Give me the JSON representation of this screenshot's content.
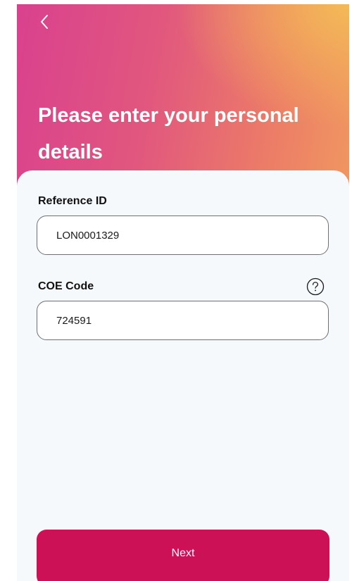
{
  "header": {
    "back_icon": "chevron-left-icon",
    "title": "Please enter your personal details"
  },
  "form": {
    "reference_id": {
      "label": "Reference ID",
      "value": "LON0001329"
    },
    "coe_code": {
      "label": "COE Code",
      "value": "724591",
      "help_icon": "question-circle-icon"
    }
  },
  "footer": {
    "next_label": "Next"
  },
  "colors": {
    "gradient_start": "#d9418e",
    "gradient_end": "#f4bc56",
    "accent": "#cd1157",
    "card_background": "#f6f9fc"
  }
}
